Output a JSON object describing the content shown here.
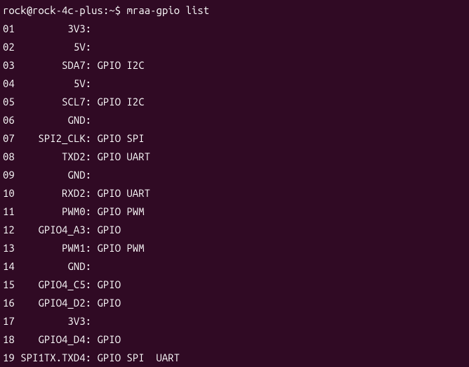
{
  "prompt": {
    "user_host": "rock@rock-4c-plus",
    "separator": ":",
    "path": "~",
    "dollar": "$",
    "command": "mraa-gpio list"
  },
  "rows": [
    {
      "pin": "01",
      "name": "3V3",
      "caps": ""
    },
    {
      "pin": "02",
      "name": "5V",
      "caps": ""
    },
    {
      "pin": "03",
      "name": "SDA7",
      "caps": "GPIO I2C"
    },
    {
      "pin": "04",
      "name": "5V",
      "caps": ""
    },
    {
      "pin": "05",
      "name": "SCL7",
      "caps": "GPIO I2C"
    },
    {
      "pin": "06",
      "name": "GND",
      "caps": ""
    },
    {
      "pin": "07",
      "name": "SPI2_CLK",
      "caps": "GPIO SPI"
    },
    {
      "pin": "08",
      "name": "TXD2",
      "caps": "GPIO UART"
    },
    {
      "pin": "09",
      "name": "GND",
      "caps": ""
    },
    {
      "pin": "10",
      "name": "RXD2",
      "caps": "GPIO UART"
    },
    {
      "pin": "11",
      "name": "PWM0",
      "caps": "GPIO PWM"
    },
    {
      "pin": "12",
      "name": "GPIO4_A3",
      "caps": "GPIO"
    },
    {
      "pin": "13",
      "name": "PWM1",
      "caps": "GPIO PWM"
    },
    {
      "pin": "14",
      "name": "GND",
      "caps": ""
    },
    {
      "pin": "15",
      "name": "GPIO4_C5",
      "caps": "GPIO"
    },
    {
      "pin": "16",
      "name": "GPIO4_D2",
      "caps": "GPIO"
    },
    {
      "pin": "17",
      "name": "3V3",
      "caps": ""
    },
    {
      "pin": "18",
      "name": "GPIO4_D4",
      "caps": "GPIO"
    },
    {
      "pin": "19",
      "name": "SPI1TX.TXD4",
      "caps": "GPIO SPI  UART"
    }
  ]
}
